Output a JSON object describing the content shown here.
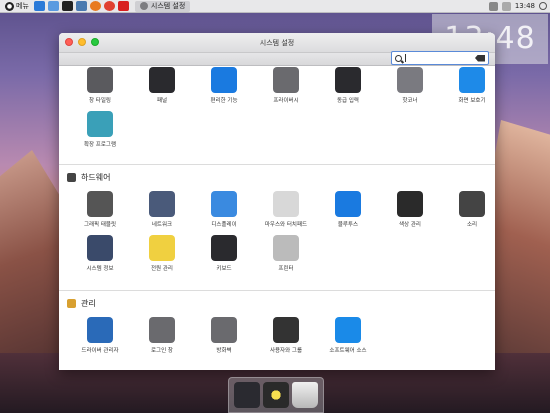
{
  "panel": {
    "menu_label": "메뉴",
    "task_label": "시스템 설정",
    "clock": "13:48",
    "quick_launch": [
      "browser-icon",
      "mail-icon",
      "terminal-icon",
      "files-icon",
      "firefox-icon",
      "chrome-icon",
      "media-icon"
    ]
  },
  "desktop_clock": "13:48",
  "window": {
    "title": "시스템 설정",
    "search_value": "",
    "search_placeholder": ""
  },
  "personal_items": [
    {
      "label": "창 타일링",
      "icon": "window-tiling-icon",
      "color": "#5a5a5e"
    },
    {
      "label": "패널",
      "icon": "panel-icon",
      "color": "#2a2a2e"
    },
    {
      "label": "편리한 기능",
      "icon": "accessibility-icon",
      "color": "#1a7ae0"
    },
    {
      "label": "프라이버시",
      "icon": "privacy-icon",
      "color": "#6a6a6e"
    },
    {
      "label": "동급 입력",
      "icon": "keyboard-shortcut-icon",
      "color": "#2a2a2e"
    },
    {
      "label": "핫코너",
      "icon": "hot-corner-icon",
      "color": "#7a7a80"
    },
    {
      "label": "화면 보호기",
      "icon": "screensaver-icon",
      "color": "#1e8ae8"
    },
    {
      "label": "확장 프로그램",
      "icon": "extensions-icon",
      "color": "#3aa0b8"
    }
  ],
  "hardware": {
    "title": "하드웨어",
    "items": [
      {
        "label": "그래픽 태블릿",
        "icon": "tablet-icon",
        "color": "#555"
      },
      {
        "label": "네트워크",
        "icon": "network-icon",
        "color": "#4a5a7a"
      },
      {
        "label": "디스플레이",
        "icon": "display-icon",
        "color": "#3a8ae0"
      },
      {
        "label": "마우스와 터치패드",
        "icon": "mouse-icon",
        "color": "#d8d8d8"
      },
      {
        "label": "블루투스",
        "icon": "bluetooth-icon",
        "color": "#1a7ae0"
      },
      {
        "label": "색상 관리",
        "icon": "color-management-icon",
        "color": "#2a2a2a"
      },
      {
        "label": "소리",
        "icon": "sound-icon",
        "color": "#444"
      },
      {
        "label": "시스템 정보",
        "icon": "system-info-icon",
        "color": "#3a4a6a"
      },
      {
        "label": "전원 관리",
        "icon": "power-icon",
        "color": "#f0d040"
      },
      {
        "label": "키보드",
        "icon": "keyboard-icon",
        "color": "#2a2a2e"
      },
      {
        "label": "프린터",
        "icon": "printer-icon",
        "color": "#bbb"
      }
    ]
  },
  "admin": {
    "title": "관리",
    "items": [
      {
        "label": "드라이버 관리자",
        "icon": "driver-icon",
        "color": "#2a6ab8"
      },
      {
        "label": "로그인 창",
        "icon": "login-icon",
        "color": "#6a6a6e"
      },
      {
        "label": "방화벽",
        "icon": "firewall-icon",
        "color": "#6a6a6e"
      },
      {
        "label": "사용자와 그룹",
        "icon": "users-icon",
        "color": "#333"
      },
      {
        "label": "소프트웨어 소스",
        "icon": "software-source-icon",
        "color": "#1a8ae8"
      }
    ]
  },
  "dock": [
    "system-settings-icon",
    "color-management-icon",
    "trash-icon"
  ]
}
